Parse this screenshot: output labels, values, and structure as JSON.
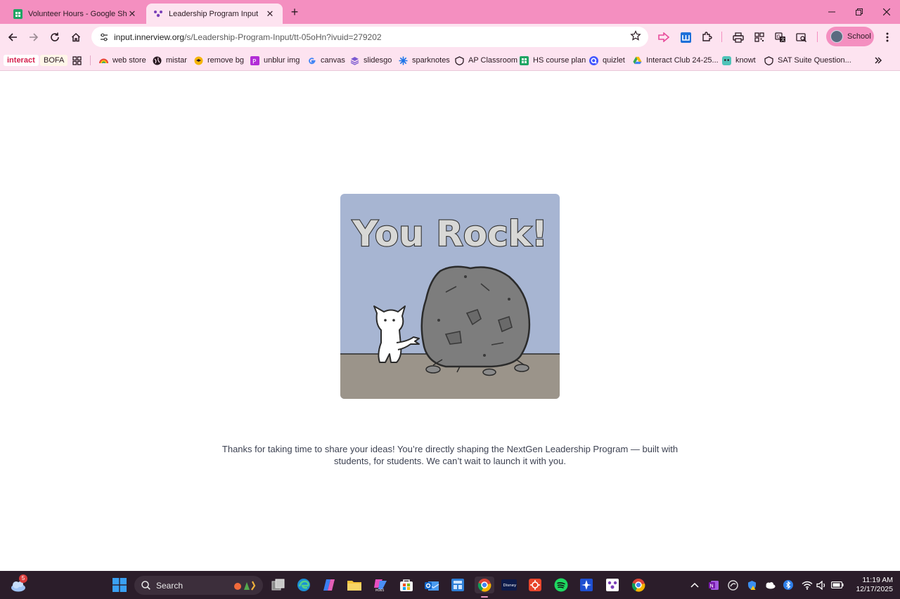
{
  "tabs": [
    {
      "title": "Volunteer Hours - Google Sheets",
      "favicon": "sheets-icon",
      "active": false
    },
    {
      "title": "Leadership Program Input",
      "favicon": "innerview-icon",
      "active": true
    }
  ],
  "address": {
    "host": "input.innerview.org",
    "path": "/s/Leadership-Program-Input/tt-05oHn?ivuid=279202"
  },
  "profile": {
    "label": "School"
  },
  "bookmarks": [
    {
      "label": "interact",
      "icon": "interact-chip"
    },
    {
      "label": "BOFA",
      "icon": "bofa-chip"
    },
    {
      "label": "web store",
      "icon": "webstore-icon"
    },
    {
      "label": "mistar",
      "icon": "globe-icon"
    },
    {
      "label": "remove bg",
      "icon": "removebg-icon"
    },
    {
      "label": "unblur img",
      "icon": "unblur-icon"
    },
    {
      "label": "canvas",
      "icon": "google-icon"
    },
    {
      "label": "slidesgo",
      "icon": "slidesgo-icon"
    },
    {
      "label": "sparknotes",
      "icon": "sparknotes-icon"
    },
    {
      "label": "AP Classroom",
      "icon": "apclassroom-icon"
    },
    {
      "label": "HS course plan",
      "icon": "sheets-icon"
    },
    {
      "label": "quizlet",
      "icon": "quizlet-icon"
    },
    {
      "label": "Interact Club 24-25...",
      "icon": "drive-icon"
    },
    {
      "label": "knowt",
      "icon": "knowt-icon"
    },
    {
      "label": "SAT Suite Question...",
      "icon": "sat-icon"
    }
  ],
  "page": {
    "image_title": "You Rock!",
    "message": "Thanks for taking  time to share your ideas! You’re directly shaping the NextGen Leadership Program — built with students, for students. We can’t wait to launch it with you."
  },
  "taskbar": {
    "search_label": "Search",
    "weather_badge": "5",
    "time": "11:19 AM",
    "date": "12/17/2025"
  },
  "colors": {
    "tab_strip": "#f48fc0",
    "toolbar": "#fde3f0",
    "taskbar": "#2b1d2a",
    "image_sky": "#a7b5d2",
    "image_ground": "#9b948a"
  }
}
